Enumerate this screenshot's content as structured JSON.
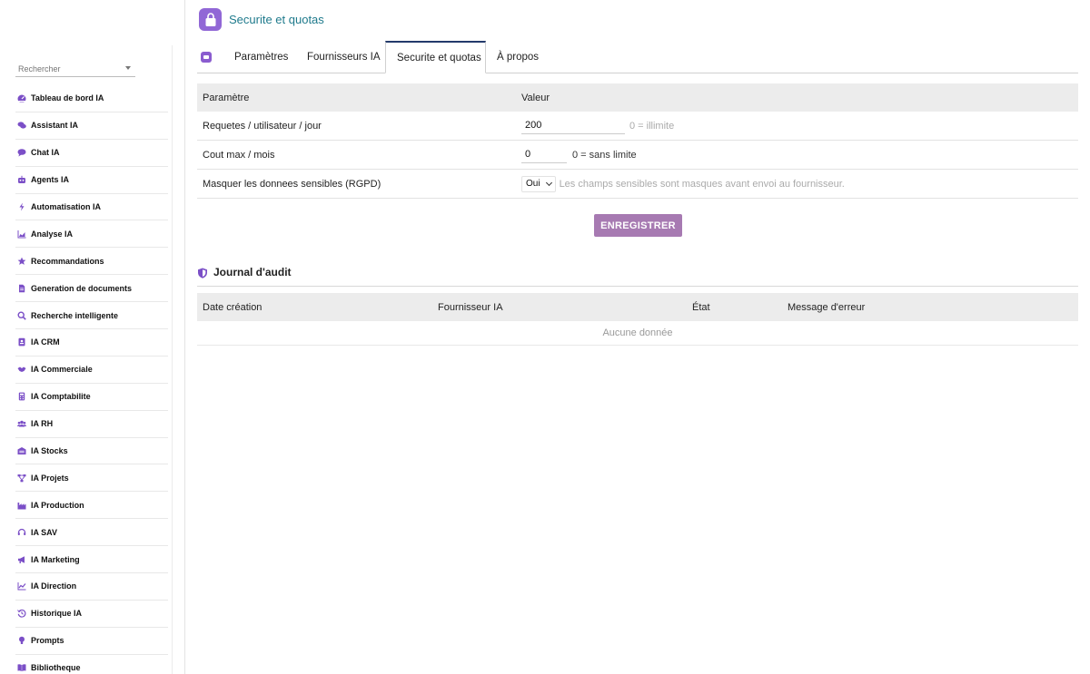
{
  "page": {
    "title": "Securite et quotas"
  },
  "sidebar": {
    "search_placeholder": "Rechercher",
    "items": [
      {
        "label": "Tableau de bord IA",
        "icon": "dashboard-icon"
      },
      {
        "label": "Assistant IA",
        "icon": "comments-icon"
      },
      {
        "label": "Chat IA",
        "icon": "chat-icon"
      },
      {
        "label": "Agents IA",
        "icon": "robot-icon"
      },
      {
        "label": "Automatisation IA",
        "icon": "bolt-icon"
      },
      {
        "label": "Analyse IA",
        "icon": "chart-area-icon"
      },
      {
        "label": "Recommandations",
        "icon": "star-icon"
      },
      {
        "label": "Generation de documents",
        "icon": "file-icon"
      },
      {
        "label": "Recherche intelligente",
        "icon": "search-icon"
      },
      {
        "label": "IA CRM",
        "icon": "contact-card-icon"
      },
      {
        "label": "IA Commerciale",
        "icon": "handshake-icon"
      },
      {
        "label": "IA Comptabilite",
        "icon": "calculator-icon"
      },
      {
        "label": "IA RH",
        "icon": "users-icon"
      },
      {
        "label": "IA Stocks",
        "icon": "warehouse-icon"
      },
      {
        "label": "IA Projets",
        "icon": "project-diagram-icon"
      },
      {
        "label": "IA Production",
        "icon": "industry-icon"
      },
      {
        "label": "IA SAV",
        "icon": "headset-icon"
      },
      {
        "label": "IA Marketing",
        "icon": "bullhorn-icon"
      },
      {
        "label": "IA Direction",
        "icon": "line-chart-icon"
      },
      {
        "label": "Historique IA",
        "icon": "history-icon"
      },
      {
        "label": "Prompts",
        "icon": "lightbulb-icon"
      },
      {
        "label": "Bibliotheque",
        "icon": "book-icon"
      }
    ]
  },
  "tabs": [
    {
      "label": "Paramètres"
    },
    {
      "label": "Fournisseurs IA"
    },
    {
      "label": "Securite et quotas",
      "active": true
    },
    {
      "label": "À propos"
    }
  ],
  "params": {
    "header": {
      "param": "Paramètre",
      "value": "Valeur"
    },
    "rows": [
      {
        "label": "Requetes / utilisateur / jour",
        "value": "200",
        "hint": "0 = illimite"
      },
      {
        "label": "Cout max / mois",
        "value": "0",
        "hint": "0 = sans limite"
      },
      {
        "label": "Masquer les donnees sensibles (RGPD)",
        "value": "Oui",
        "hint": "Les champs sensibles sont masques avant envoi au fournisseur."
      }
    ],
    "save_label": "ENREGISTRER"
  },
  "audit": {
    "title": "Journal d'audit",
    "columns": [
      "Date création",
      "Fournisseur IA",
      "État",
      "Message d'erreur"
    ],
    "empty": "Aucune donnée"
  },
  "colors": {
    "accent": "#9167d6",
    "title": "#1f7a8c",
    "button": "#a77ab2",
    "active_tab_border": "#233a6b"
  }
}
